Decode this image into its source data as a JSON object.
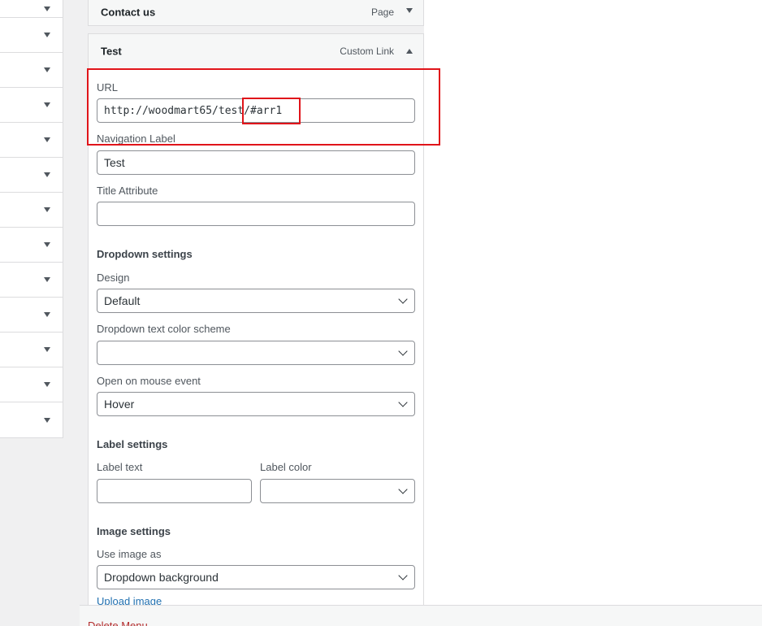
{
  "menu_items": [
    {
      "title": "Contact us",
      "type": "Page"
    },
    {
      "title": "Test",
      "type": "Custom Link"
    }
  ],
  "form": {
    "url_label": "URL",
    "url_value": "http://woodmart65/test/#arr1",
    "nav_label": "Navigation Label",
    "nav_value": "Test",
    "title_attr_label": "Title Attribute",
    "title_attr_value": "",
    "dropdown_heading": "Dropdown settings",
    "design_label": "Design",
    "design_value": "Default",
    "color_scheme_label": "Dropdown text color scheme",
    "color_scheme_value": "",
    "mouse_event_label": "Open on mouse event",
    "mouse_event_value": "Hover",
    "label_heading": "Label settings",
    "label_text_label": "Label text",
    "label_text_value": "",
    "label_color_label": "Label color",
    "label_color_value": "",
    "image_heading": "Image settings",
    "use_image_label": "Use image as",
    "use_image_value": "Dropdown background",
    "upload_link": "Upload image"
  },
  "footer": {
    "delete_link": "Delete Menu"
  },
  "colors": {
    "highlight": "#e0141a",
    "link": "#2271b1",
    "delete": "#b32d2e"
  }
}
